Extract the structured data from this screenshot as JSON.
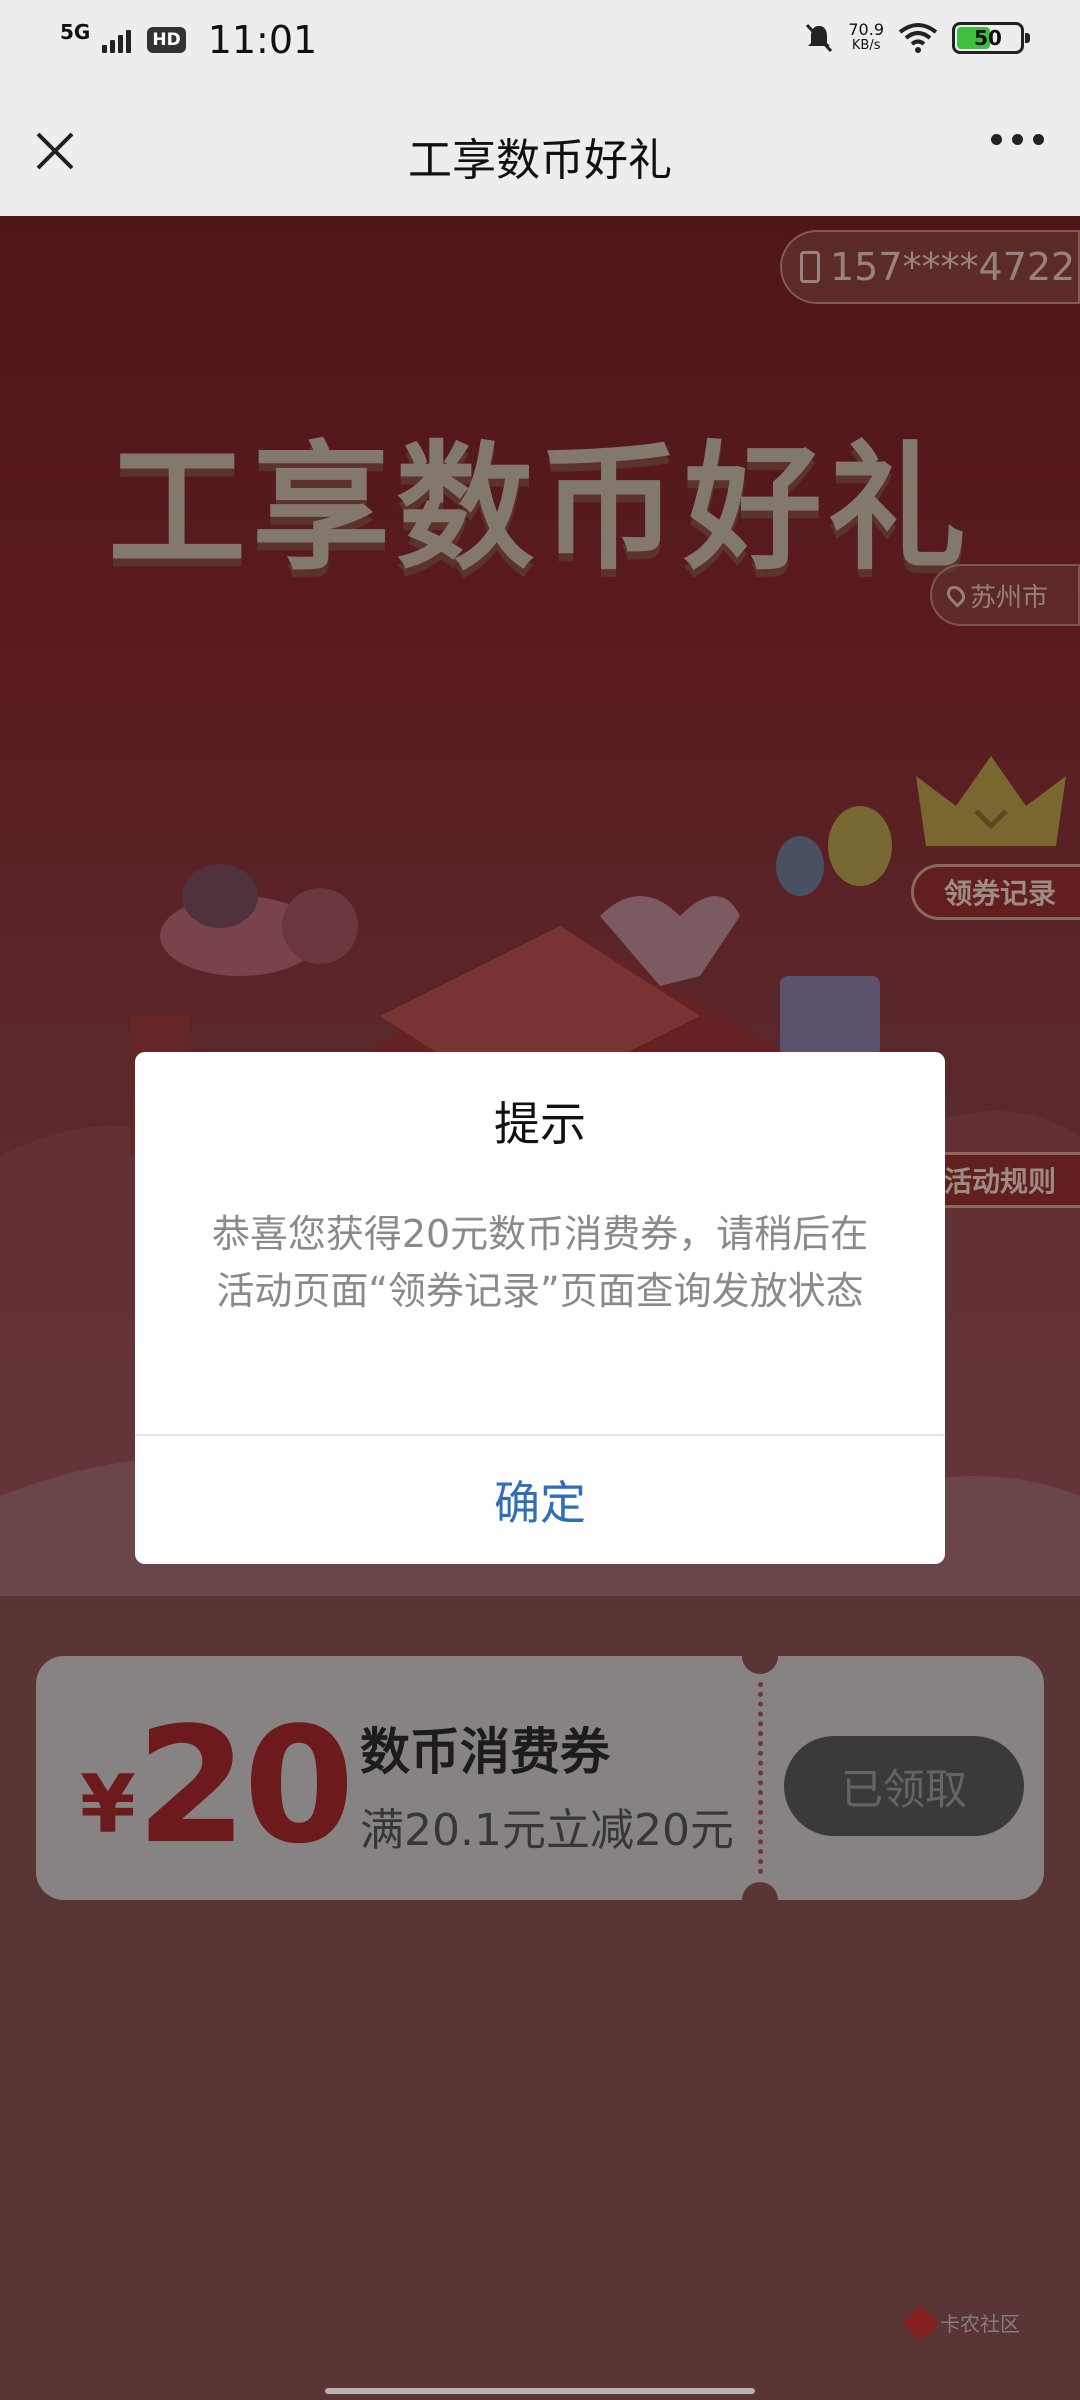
{
  "status_bar": {
    "network": "5G",
    "hd": "HD",
    "time": "11:01",
    "speed_value": "70.9",
    "speed_unit": "KB/s",
    "battery": "50"
  },
  "nav": {
    "title": "工享数币好礼"
  },
  "hero": {
    "phone": "157****4722",
    "title": "工享数币好礼",
    "city": "苏州市",
    "coupon_records": "领券记录",
    "activity_rules": "活动规则"
  },
  "dialog": {
    "title": "提示",
    "message": "恭喜您获得20元数币消费券，请稍后在活动页面“领券记录”页面查询发放状态",
    "confirm": "确定"
  },
  "coupon": {
    "currency": "¥",
    "amount": "20",
    "name": "数币消费券",
    "rule": "满20.1元立减20元",
    "button": "已领取"
  },
  "watermark": "卡农社区",
  "colors": {
    "accent_red": "#a7282a",
    "link_blue": "#2f6fb8"
  }
}
